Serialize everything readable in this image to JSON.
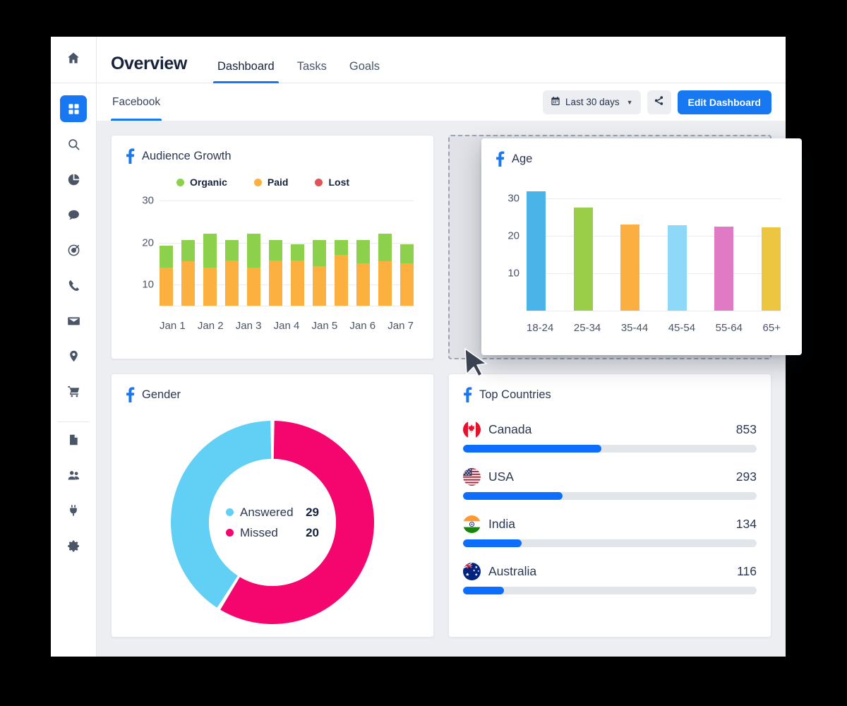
{
  "header": {
    "title": "Overview",
    "home_icon": "home-icon",
    "tabs": [
      {
        "label": "Dashboard",
        "active": true
      },
      {
        "label": "Tasks",
        "active": false
      },
      {
        "label": "Goals",
        "active": false
      }
    ]
  },
  "subheader": {
    "channel_tab": "Facebook",
    "date_range": {
      "icon": "calendar-icon",
      "label": "Last 30 days",
      "caret": "▼"
    },
    "share_icon": "share-icon",
    "edit_button": "Edit Dashboard"
  },
  "sidebar": {
    "items": [
      {
        "name": "grid-icon",
        "label": "Dashboard",
        "active": true
      },
      {
        "name": "search-icon",
        "label": "Search",
        "active": false
      },
      {
        "name": "pie-chart-icon",
        "label": "Analytics",
        "active": false
      },
      {
        "name": "chat-bubble-icon",
        "label": "Messages",
        "active": false
      },
      {
        "name": "target-icon",
        "label": "Campaigns",
        "active": false
      },
      {
        "name": "phone-icon",
        "label": "Calls",
        "active": false
      },
      {
        "name": "envelope-icon",
        "label": "Email",
        "active": false
      },
      {
        "name": "location-pin-icon",
        "label": "Locations",
        "active": false
      },
      {
        "name": "shopping-cart-icon",
        "label": "Commerce",
        "active": false
      }
    ],
    "bottom_items": [
      {
        "name": "document-icon",
        "label": "Documents"
      },
      {
        "name": "users-icon",
        "label": "Team"
      },
      {
        "name": "plug-icon",
        "label": "Integrations"
      },
      {
        "name": "gear-icon",
        "label": "Settings"
      }
    ]
  },
  "colors": {
    "accent_blue": "#1778f2",
    "progress_blue": "#0d6efd",
    "organic_green": "#8dd04b",
    "paid_orange": "#fbb040",
    "lost_red": "#e0535a",
    "answered_blue": "#62d0f5",
    "missed_pink": "#f5056e",
    "canvas_gray": "#eceef2"
  },
  "cards": {
    "audience_growth": {
      "title": "Audience Growth",
      "source_icon": "facebook-icon"
    },
    "age": {
      "title": "Age",
      "source_icon": "facebook-icon",
      "floating": true
    },
    "gender": {
      "title": "Gender",
      "source_icon": "facebook-icon"
    },
    "top_countries": {
      "title": "Top Countries",
      "source_icon": "facebook-icon"
    }
  },
  "chart_data": [
    {
      "id": "audience-growth",
      "type": "bar",
      "title": "Audience Growth",
      "stacked": true,
      "xlabel": "",
      "ylabel": "",
      "ylim": [
        5,
        31
      ],
      "yticks": [
        10,
        20,
        30
      ],
      "grid": true,
      "legend": [
        {
          "name": "Organic",
          "color": "#8dd04b"
        },
        {
          "name": "Paid",
          "color": "#fbb040"
        },
        {
          "name": "Lost",
          "color": "#e0535a"
        }
      ],
      "categories": [
        "Jan 1",
        "Jan 2",
        "Jan 3",
        "Jan 4",
        "Jan 5",
        "Jan 6",
        "Jan 7"
      ],
      "bar_count": 12,
      "series": [
        {
          "name": "Paid",
          "color": "#fbb040",
          "values": [
            14,
            15.6,
            14,
            15.7,
            14.1,
            15.7,
            15.7,
            14.4,
            17,
            15.1,
            15.6,
            15.1
          ]
        },
        {
          "name": "Organic",
          "color": "#8dd04b",
          "values": [
            19.2,
            20.6,
            22.1,
            20.6,
            22.1,
            20.6,
            19.6,
            20.6,
            20.6,
            20.6,
            22.1,
            19.6
          ]
        }
      ],
      "note": "Each bar is a stack: orange from baseline to Paid value, green from Paid value up to the Organic total."
    },
    {
      "id": "age",
      "type": "bar",
      "title": "Age",
      "xlabel": "",
      "ylabel": "",
      "ylim": [
        0,
        34
      ],
      "yticks": [
        10,
        20,
        30
      ],
      "grid": true,
      "categories": [
        "18-24",
        "25-34",
        "35-44",
        "45-54",
        "55-64",
        "65+"
      ],
      "values": [
        32,
        27.5,
        23,
        22.8,
        22.5,
        22.3
      ],
      "bar_colors": [
        "#4ab3e8",
        "#9ace48",
        "#fcaf41",
        "#8ed8f8",
        "#e07ac4",
        "#ecc640"
      ]
    },
    {
      "id": "gender",
      "type": "pie",
      "subtype": "donut",
      "title": "Gender",
      "labels": [
        "Answered",
        "Missed"
      ],
      "values": [
        29,
        20
      ],
      "colors": [
        "#62d0f5",
        "#f5056e"
      ],
      "center_legend": [
        {
          "label": "Answered",
          "value": "29",
          "color": "#62d0f5"
        },
        {
          "label": "Missed",
          "value": "20",
          "color": "#f5056e"
        }
      ],
      "note": "Missed sweeps clockwise from 12 o'clock about 212 degrees; Answered fills the remainder."
    },
    {
      "id": "top-countries",
      "type": "bar",
      "orientation": "horizontal",
      "title": "Top Countries",
      "categories": [
        "Canada",
        "USA",
        "India",
        "Australia"
      ],
      "values": [
        853,
        293,
        134,
        116
      ],
      "percents": [
        47,
        34,
        20,
        14
      ],
      "flags": [
        "flag-canada",
        "flag-usa",
        "flag-india",
        "flag-australia"
      ],
      "bar_color": "#0d6efd"
    }
  ]
}
